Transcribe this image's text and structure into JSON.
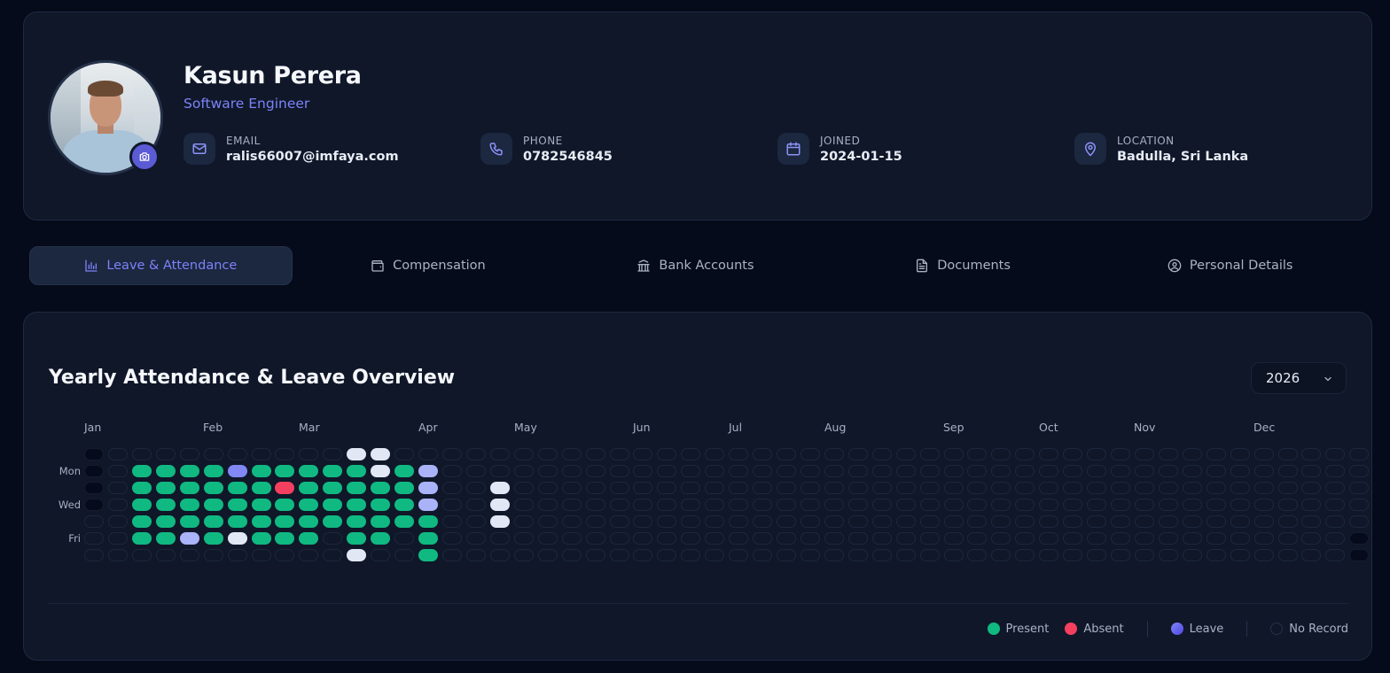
{
  "profile": {
    "name": "Kasun Perera",
    "role": "Software Engineer",
    "info": [
      {
        "label": "EMAIL",
        "value": "ralis66007@imfaya.com",
        "icon": "mail-icon"
      },
      {
        "label": "PHONE",
        "value": "0782546845",
        "icon": "phone-icon"
      },
      {
        "label": "JOINED",
        "value": "2024-01-15",
        "icon": "calendar-icon"
      },
      {
        "label": "LOCATION",
        "value": "Badulla, Sri Lanka",
        "icon": "map-pin-icon"
      }
    ]
  },
  "tabs": [
    {
      "label": "Leave & Attendance",
      "icon": "bar-chart-icon",
      "active": true
    },
    {
      "label": "Compensation",
      "icon": "wallet-icon",
      "active": false
    },
    {
      "label": "Bank Accounts",
      "icon": "bank-icon",
      "active": false
    },
    {
      "label": "Documents",
      "icon": "document-icon",
      "active": false
    },
    {
      "label": "Personal Details",
      "icon": "user-circle-icon",
      "active": false
    }
  ],
  "attendance": {
    "title": "Yearly Attendance & Leave Overview",
    "year": "2026",
    "months": [
      "Jan",
      "Feb",
      "Mar",
      "Apr",
      "May",
      "Jun",
      "Jul",
      "Aug",
      "Sep",
      "Oct",
      "Nov",
      "Dec"
    ],
    "day_labels": [
      "Mon",
      "Wed",
      "Fri"
    ],
    "legend": [
      {
        "label": "Present",
        "color": "#10b981"
      },
      {
        "label": "Absent",
        "color": "#f43f5e"
      },
      {
        "label": "Leave",
        "color": "#6366f1"
      },
      {
        "label": "No Record",
        "color": "#0f1729"
      }
    ],
    "status_colors": {
      "present": "#10b981",
      "absent": "#f43f5e",
      "leave": "#8187f5",
      "leave_light": "#aab2f8",
      "holiday": "#e2e7f5",
      "none": "#0f1729"
    },
    "weeks": [
      "xxxx___",
      "_______",
      "_PPPPP_",
      "_PPPPP_",
      "_PPPPL_",
      "_PPPPP_",
      "_LPPPH_",
      "_PPPPP_",
      "_PAPPP_",
      "_PPPPP_",
      "_PPPP__",
      "HPPPPPH",
      "HHPPPP_",
      "_PPPP__",
      "_LLLPPP",
      "_______",
      "_______",
      "__HHH__",
      "_______",
      "_______",
      "_______",
      "_______",
      "_______",
      "_______",
      "_______",
      "_______",
      "_______",
      "_______",
      "_______",
      "_______",
      "_______",
      "_______",
      "_______",
      "_______",
      "_______",
      "_______",
      "_______",
      "_______",
      "_______",
      "_______",
      "_______",
      "_______",
      "_______",
      "_______",
      "_______",
      "_______",
      "_______",
      "_______",
      "_______",
      "_______",
      "_______",
      "_______",
      "_______",
      "_____xx"
    ]
  }
}
